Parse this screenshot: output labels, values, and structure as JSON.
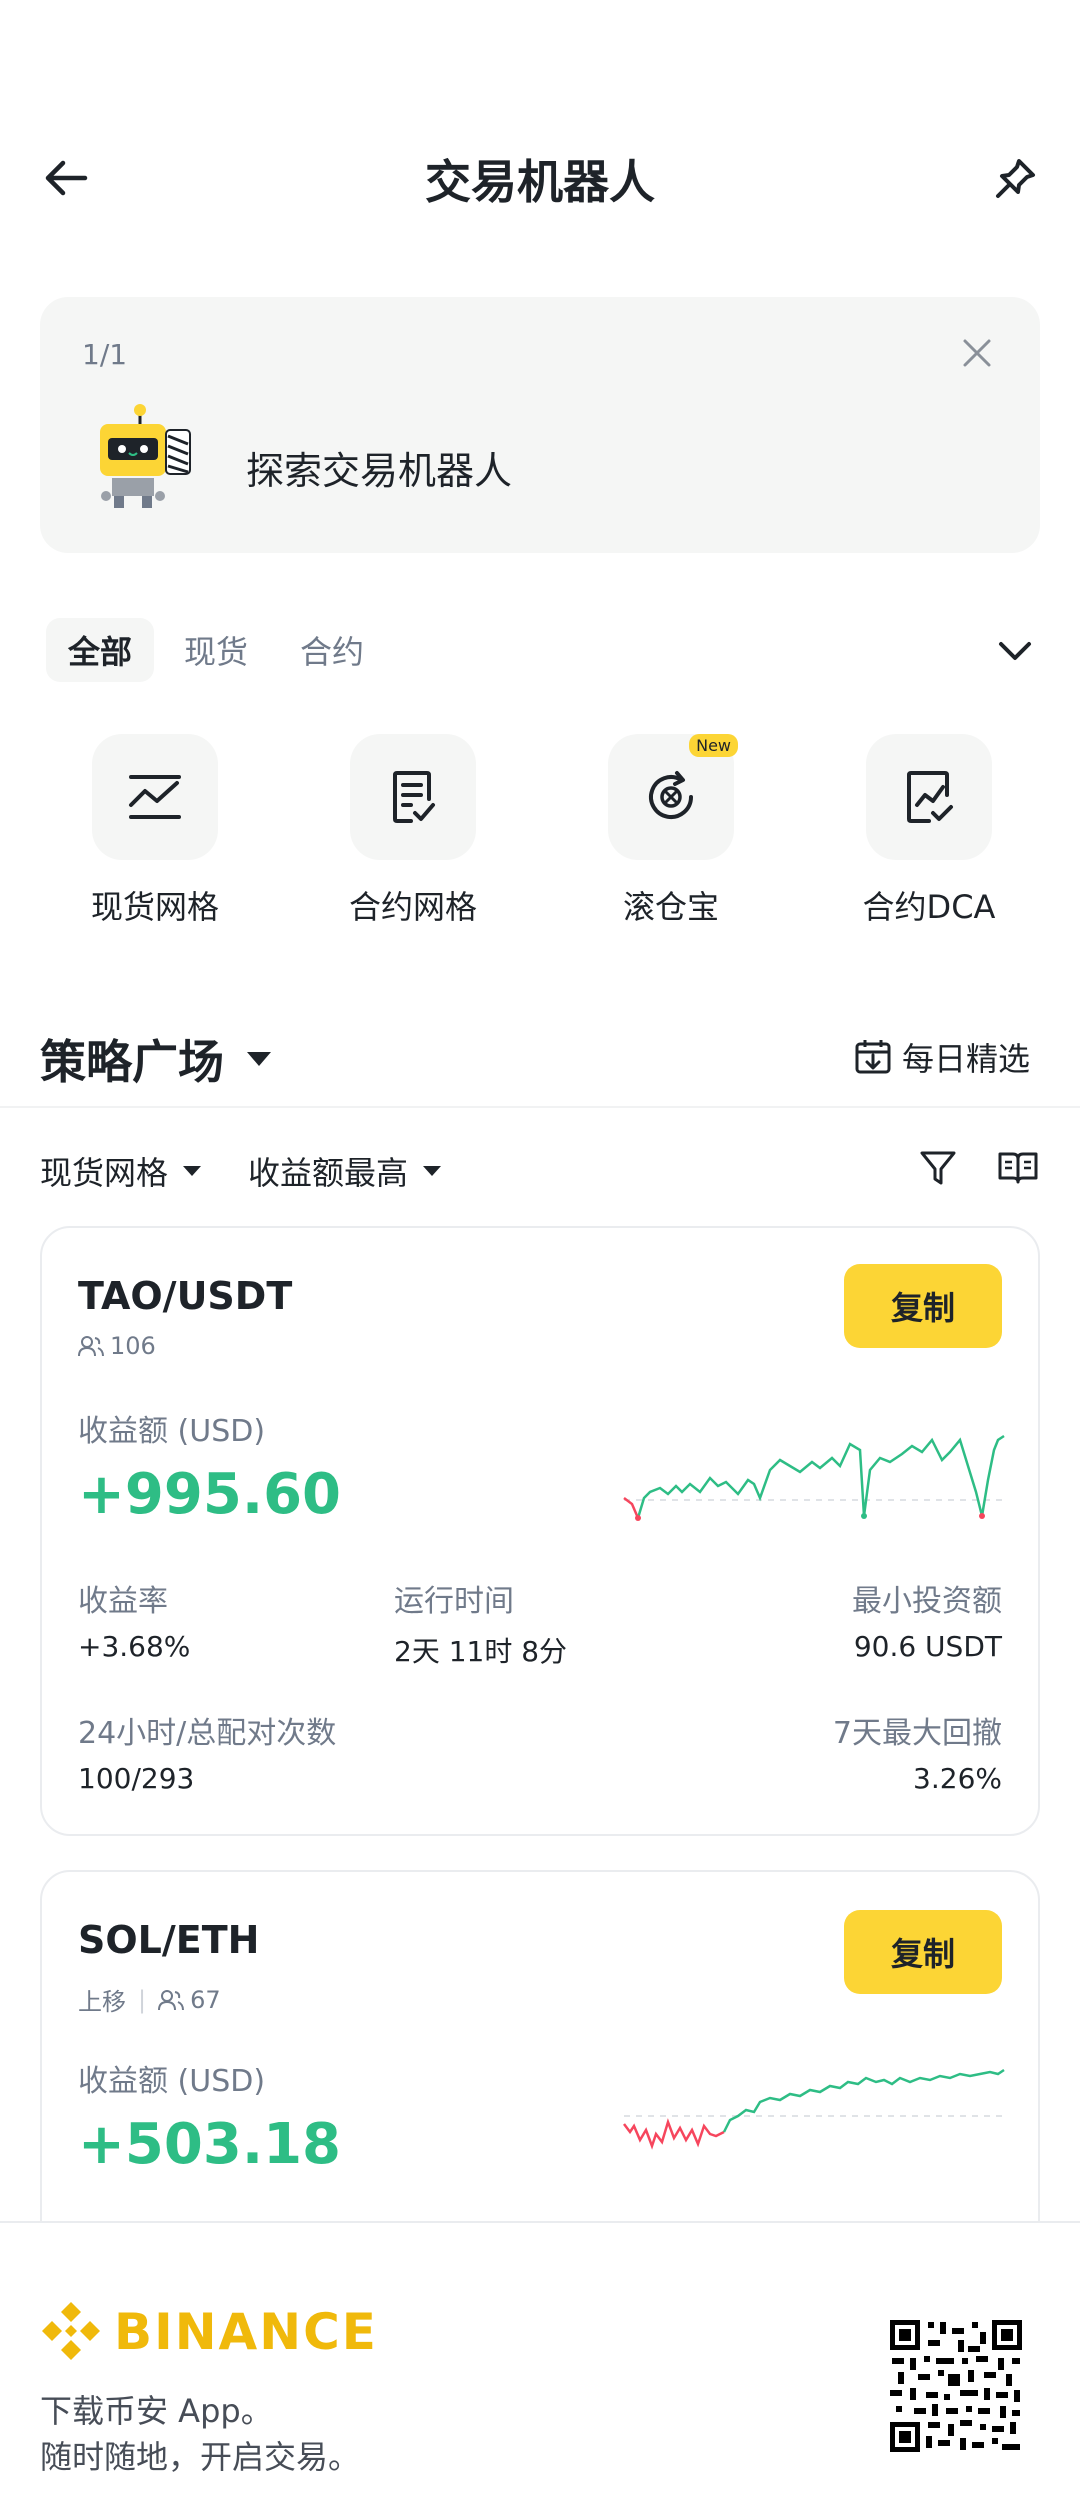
{
  "header": {
    "title": "交易机器人"
  },
  "banner": {
    "counter": "1/1",
    "text": "探索交易机器人"
  },
  "tabs": [
    {
      "label": "全部",
      "active": true
    },
    {
      "label": "现货",
      "active": false
    },
    {
      "label": "合约",
      "active": false
    }
  ],
  "bots": [
    {
      "label": "现货网格",
      "icon": "spot-grid-icon"
    },
    {
      "label": "合约网格",
      "icon": "futures-grid-icon"
    },
    {
      "label": "滚仓宝",
      "icon": "rebalance-icon",
      "badge": "New"
    },
    {
      "label": "合约DCA",
      "icon": "futures-dca-icon"
    }
  ],
  "square": {
    "title": "策略广场",
    "daily": "每日精选",
    "filter_type": "现货网格",
    "filter_sort": "收益额最高"
  },
  "cards": [
    {
      "pair": "TAO/USDT",
      "followers": "106",
      "copy_label": "复制",
      "profit_label": "收益额 (USD)",
      "profit": "+995.60",
      "stats": {
        "roi_label": "收益率",
        "roi": "+3.68%",
        "runtime_label": "运行时间",
        "runtime": "2天 11时 8分",
        "min_invest_label": "最小投资额",
        "min_invest": "90.6 USDT",
        "matches_label": "24小时/总配对次数",
        "matches": "100/293",
        "drawdown_label": "7天最大回撤",
        "drawdown": "3.26%"
      }
    },
    {
      "pair": "SOL/ETH",
      "tag": "上移",
      "followers": "67",
      "copy_label": "复制",
      "profit_label": "收益额 (USD)",
      "profit": "+503.18"
    }
  ],
  "footer": {
    "brand": "BINANCE",
    "line1": "下载币安 App。",
    "line2": "随时随地，开启交易。"
  },
  "colors": {
    "accent": "#fcd535",
    "profit_green": "#2ebd85",
    "loss_red": "#f6465d",
    "brand": "#f0b90b"
  }
}
